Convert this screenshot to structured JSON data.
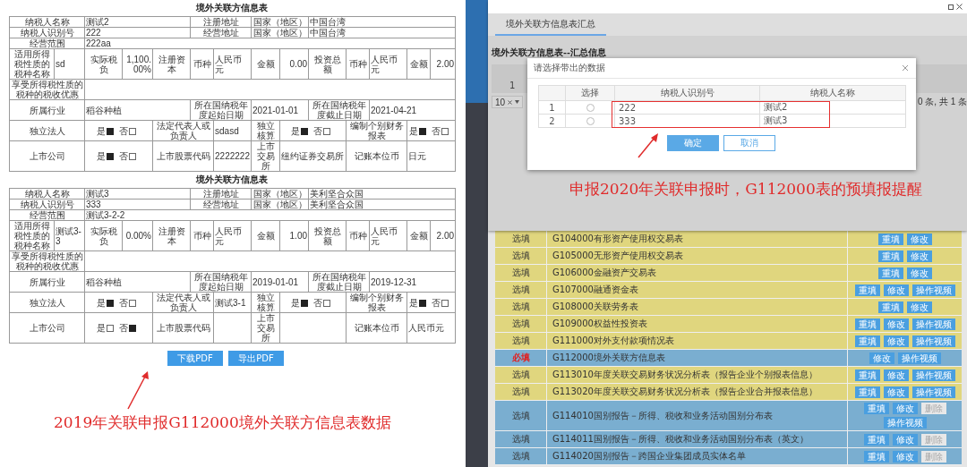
{
  "report_view": {
    "forms": [
      {
        "title": "境外关联方信息表",
        "rows": [
          [
            {
              "text": "纳税人名称",
              "colspan": 2
            },
            {
              "text": "测试2",
              "colspan": 3
            },
            {
              "text": "注册地址",
              "colspan": 2
            },
            {
              "text": "国家（地区）",
              "colspan": 2
            },
            {
              "text": "中国台湾",
              "colspan": 5
            }
          ],
          [
            {
              "text": "纳税人识别号",
              "colspan": 2
            },
            {
              "text": "222",
              "colspan": 3
            },
            {
              "text": "经营地址",
              "colspan": 2
            },
            {
              "text": "国家（地区）",
              "colspan": 2
            },
            {
              "text": "中国台湾",
              "colspan": 5
            }
          ],
          [
            {
              "text": "经营范围",
              "colspan": 2
            },
            {
              "text": "222aa",
              "colspan": 12
            }
          ],
          [
            "适用所得税性质的税种名称",
            "sd",
            "实际税负",
            "1,100.00%",
            "注册资本",
            "币种",
            "人民币元",
            "金额",
            "0.00",
            "投资总额",
            "币种",
            "人民币元",
            "金额",
            "2.00"
          ],
          [
            {
              "text": "享受所得税性质的税种的税收优惠",
              "colspan": 2
            },
            {
              "colspan": 12
            }
          ],
          [
            {
              "text": "所属行业",
              "colspan": 2
            },
            {
              "text": "稻谷种植",
              "colspan": 3
            },
            {
              "text": "所在国纳税年度起始日期",
              "colspan": 2
            },
            {
              "text": "2021-01-01",
              "colspan": 2
            },
            {
              "text": "所在国纳税年度截止日期",
              "colspan": 2
            },
            {
              "text": "2021-04-21",
              "colspan": 3
            }
          ],
          [
            {
              "text": "独立法人",
              "colspan": 2
            },
            {
              "options": [
                {
                  "label": "是",
                  "checked": true
                },
                {
                  "label": "否",
                  "checked": false
                }
              ],
              "colspan": 2
            },
            {
              "text": "法定代表人或负责人",
              "colspan": 2
            },
            "sdasd",
            "独立核算",
            {
              "options": [
                {
                  "label": "是",
                  "checked": true
                },
                {
                  "label": "否",
                  "checked": false
                }
              ],
              "colspan": 2
            },
            {
              "text": "编制个别财务报表",
              "colspan": 2
            },
            {
              "options": [
                {
                  "label": "是",
                  "checked": true
                },
                {
                  "label": "否",
                  "checked": false
                }
              ],
              "colspan": 2
            }
          ],
          [
            {
              "text": "上市公司",
              "colspan": 2
            },
            {
              "options": [
                {
                  "label": "是",
                  "checked": true
                },
                {
                  "label": "否",
                  "checked": false
                }
              ],
              "colspan": 2
            },
            {
              "text": "上市股票代码",
              "colspan": 2
            },
            "2222222",
            "上市交易所",
            {
              "text": "纽约证券交易所",
              "colspan": 2
            },
            {
              "text": "记账本位币",
              "colspan": 2
            },
            {
              "text": "日元",
              "colspan": 2
            }
          ]
        ]
      },
      {
        "title": "境外关联方信息表",
        "rows": [
          [
            {
              "text": "纳税人名称",
              "colspan": 2
            },
            {
              "text": "测试3",
              "colspan": 3
            },
            {
              "text": "注册地址",
              "colspan": 2
            },
            {
              "text": "国家（地区）",
              "colspan": 2
            },
            {
              "text": "美利坚合众国",
              "colspan": 5
            }
          ],
          [
            {
              "text": "纳税人识别号",
              "colspan": 2
            },
            {
              "text": "333",
              "colspan": 3
            },
            {
              "text": "经营地址",
              "colspan": 2
            },
            {
              "text": "国家（地区）",
              "colspan": 2
            },
            {
              "text": "美利坚合众国",
              "colspan": 5
            }
          ],
          [
            {
              "text": "经营范围",
              "colspan": 2
            },
            {
              "text": "测试3-2-2",
              "colspan": 12
            }
          ],
          [
            "适用所得税性质的税种名称",
            "测试3-3",
            "实际税负",
            "0.00%",
            "注册资本",
            "币种",
            "人民币元",
            "金额",
            "1.00",
            "投资总额",
            "币种",
            "人民币元",
            "金额",
            "2.00"
          ],
          [
            {
              "text": "享受所得税性质的税种的税收优惠",
              "colspan": 2
            },
            {
              "colspan": 12
            }
          ],
          [
            {
              "text": "所属行业",
              "colspan": 2
            },
            {
              "text": "稻谷种植",
              "colspan": 3
            },
            {
              "text": "所在国纳税年度起始日期",
              "colspan": 2
            },
            {
              "text": "2019-01-01",
              "colspan": 2
            },
            {
              "text": "所在国纳税年度截止日期",
              "colspan": 2
            },
            {
              "text": "2019-12-31",
              "colspan": 3
            }
          ],
          [
            {
              "text": "独立法人",
              "colspan": 2
            },
            {
              "options": [
                {
                  "label": "是",
                  "checked": true
                },
                {
                  "label": "否",
                  "checked": false
                }
              ],
              "colspan": 2
            },
            {
              "text": "法定代表人或负责人",
              "colspan": 2
            },
            "测试3-1",
            "独立核算",
            {
              "options": [
                {
                  "label": "是",
                  "checked": true
                },
                {
                  "label": "否",
                  "checked": false
                }
              ],
              "colspan": 2
            },
            {
              "text": "编制个别财务报表",
              "colspan": 2
            },
            {
              "options": [
                {
                  "label": "是",
                  "checked": true
                },
                {
                  "label": "否",
                  "checked": false
                }
              ],
              "colspan": 2
            }
          ],
          [
            {
              "text": "上市公司",
              "colspan": 2
            },
            {
              "options": [
                {
                  "label": "是",
                  "checked": false
                },
                {
                  "label": "否",
                  "checked": true
                }
              ],
              "colspan": 2
            },
            {
              "text": "上市股票代码",
              "colspan": 2
            },
            null,
            "上市交易所",
            {
              "colspan": 2
            },
            {
              "text": "记账本位币",
              "colspan": 2
            },
            {
              "text": "人民币元",
              "colspan": 2
            }
          ]
        ]
      }
    ],
    "buttons": [
      "下载PDF",
      "导出PDF"
    ],
    "caption": "2019年关联申报G112000境外关联方信息表数据"
  },
  "summary_window": {
    "tab": {
      "label": "境外关联方信息表汇总",
      "selected": true
    },
    "section_title": "境外关联方信息表--汇总信息",
    "row_number": "1",
    "page_size": "10",
    "page_info": "0 条, 共 1 条",
    "dialog": {
      "title": "请选择带出的数据",
      "columns": [
        "选择",
        "纳税人识别号",
        "纳税人名称"
      ],
      "rows": [
        {
          "index": "1",
          "selected": false,
          "taxpayer_id": "222",
          "taxpayer_name": "测试2"
        },
        {
          "index": "2",
          "selected": false,
          "taxpayer_id": "333",
          "taxpayer_name": "测试3"
        }
      ],
      "buttons": [
        {
          "label": "确定",
          "kind": "primary"
        },
        {
          "label": "取消",
          "kind": "secondary"
        }
      ]
    },
    "caption": "申报2020年关联申报时，G112000表的预填报提醒"
  },
  "task_list": {
    "rows": [
      {
        "requirement": "选填",
        "required": false,
        "name": "G104000有形资产使用权交易表",
        "color": "#e0d67e",
        "actions": [
          {
            "label": "重填",
            "disabled": false
          },
          {
            "label": "修改",
            "disabled": false
          }
        ]
      },
      {
        "requirement": "选填",
        "required": false,
        "name": "G105000无形资产使用权交易表",
        "color": "#e0d67e",
        "actions": [
          {
            "label": "重填",
            "disabled": false
          },
          {
            "label": "修改",
            "disabled": false
          }
        ]
      },
      {
        "requirement": "选填",
        "required": false,
        "name": "G106000金融资产交易表",
        "color": "#e0d67e",
        "actions": [
          {
            "label": "重填",
            "disabled": false
          },
          {
            "label": "修改",
            "disabled": false
          }
        ]
      },
      {
        "requirement": "选填",
        "required": false,
        "name": "G107000融通资金表",
        "color": "#e0d67e",
        "actions": [
          {
            "label": "重填",
            "disabled": false
          },
          {
            "label": "修改",
            "disabled": false
          },
          {
            "label": "操作视频",
            "disabled": false
          }
        ]
      },
      {
        "requirement": "选填",
        "required": false,
        "name": "G108000关联劳务表",
        "color": "#e0d67e",
        "actions": [
          {
            "label": "重填",
            "disabled": false
          },
          {
            "label": "修改",
            "disabled": false
          }
        ]
      },
      {
        "requirement": "选填",
        "required": false,
        "name": "G109000权益性投资表",
        "color": "#e0d67e",
        "actions": [
          {
            "label": "重填",
            "disabled": false
          },
          {
            "label": "修改",
            "disabled": false
          },
          {
            "label": "操作视频",
            "disabled": false
          }
        ]
      },
      {
        "requirement": "选填",
        "required": false,
        "name": "G111000对外支付款项情况表",
        "color": "#e0d67e",
        "actions": [
          {
            "label": "重填",
            "disabled": false
          },
          {
            "label": "修改",
            "disabled": false
          },
          {
            "label": "操作视频",
            "disabled": false
          }
        ]
      },
      {
        "requirement": "必填",
        "required": true,
        "name": "G112000境外关联方信息表",
        "color": "#7aaed0",
        "actions": [
          {
            "label": "修改",
            "disabled": false
          },
          {
            "label": "操作视频",
            "disabled": false
          }
        ]
      },
      {
        "requirement": "选填",
        "required": false,
        "name": "G113010年度关联交易财务状况分析表（报告企业个别报表信息）",
        "color": "#e0d67e",
        "actions": [
          {
            "label": "重填",
            "disabled": false
          },
          {
            "label": "修改",
            "disabled": false
          },
          {
            "label": "操作视频",
            "disabled": false
          }
        ]
      },
      {
        "requirement": "选填",
        "required": false,
        "name": "G113020年度关联交易财务状况分析表（报告企业合并报表信息）",
        "color": "#e0d67e",
        "actions": [
          {
            "label": "重填",
            "disabled": false
          },
          {
            "label": "修改",
            "disabled": false
          },
          {
            "label": "操作视频",
            "disabled": false
          }
        ]
      },
      {
        "requirement": "选填",
        "required": false,
        "name": "G114010国别报告－所得、税收和业务活动国别分布表",
        "color": "#7aaed0",
        "actions": [
          {
            "label": "重填",
            "disabled": false
          },
          {
            "label": "修改",
            "disabled": false
          },
          {
            "label": "删除",
            "disabled": true
          },
          {
            "label": "操作视频",
            "disabled": false
          }
        ]
      },
      {
        "requirement": "选填",
        "required": false,
        "name": "G114011国别报告－所得、税收和业务活动国别分布表（英文）",
        "color": "#7aaed0",
        "actions": [
          {
            "label": "重填",
            "disabled": false
          },
          {
            "label": "修改",
            "disabled": false
          },
          {
            "label": "删除",
            "disabled": true
          }
        ]
      },
      {
        "requirement": "选填",
        "required": false,
        "name": "G114020国别报告－跨国企业集团成员实体名单",
        "color": "#7aaed0",
        "actions": [
          {
            "label": "重填",
            "disabled": false
          },
          {
            "label": "修改",
            "disabled": false
          },
          {
            "label": "删除",
            "disabled": true
          }
        ]
      }
    ]
  }
}
